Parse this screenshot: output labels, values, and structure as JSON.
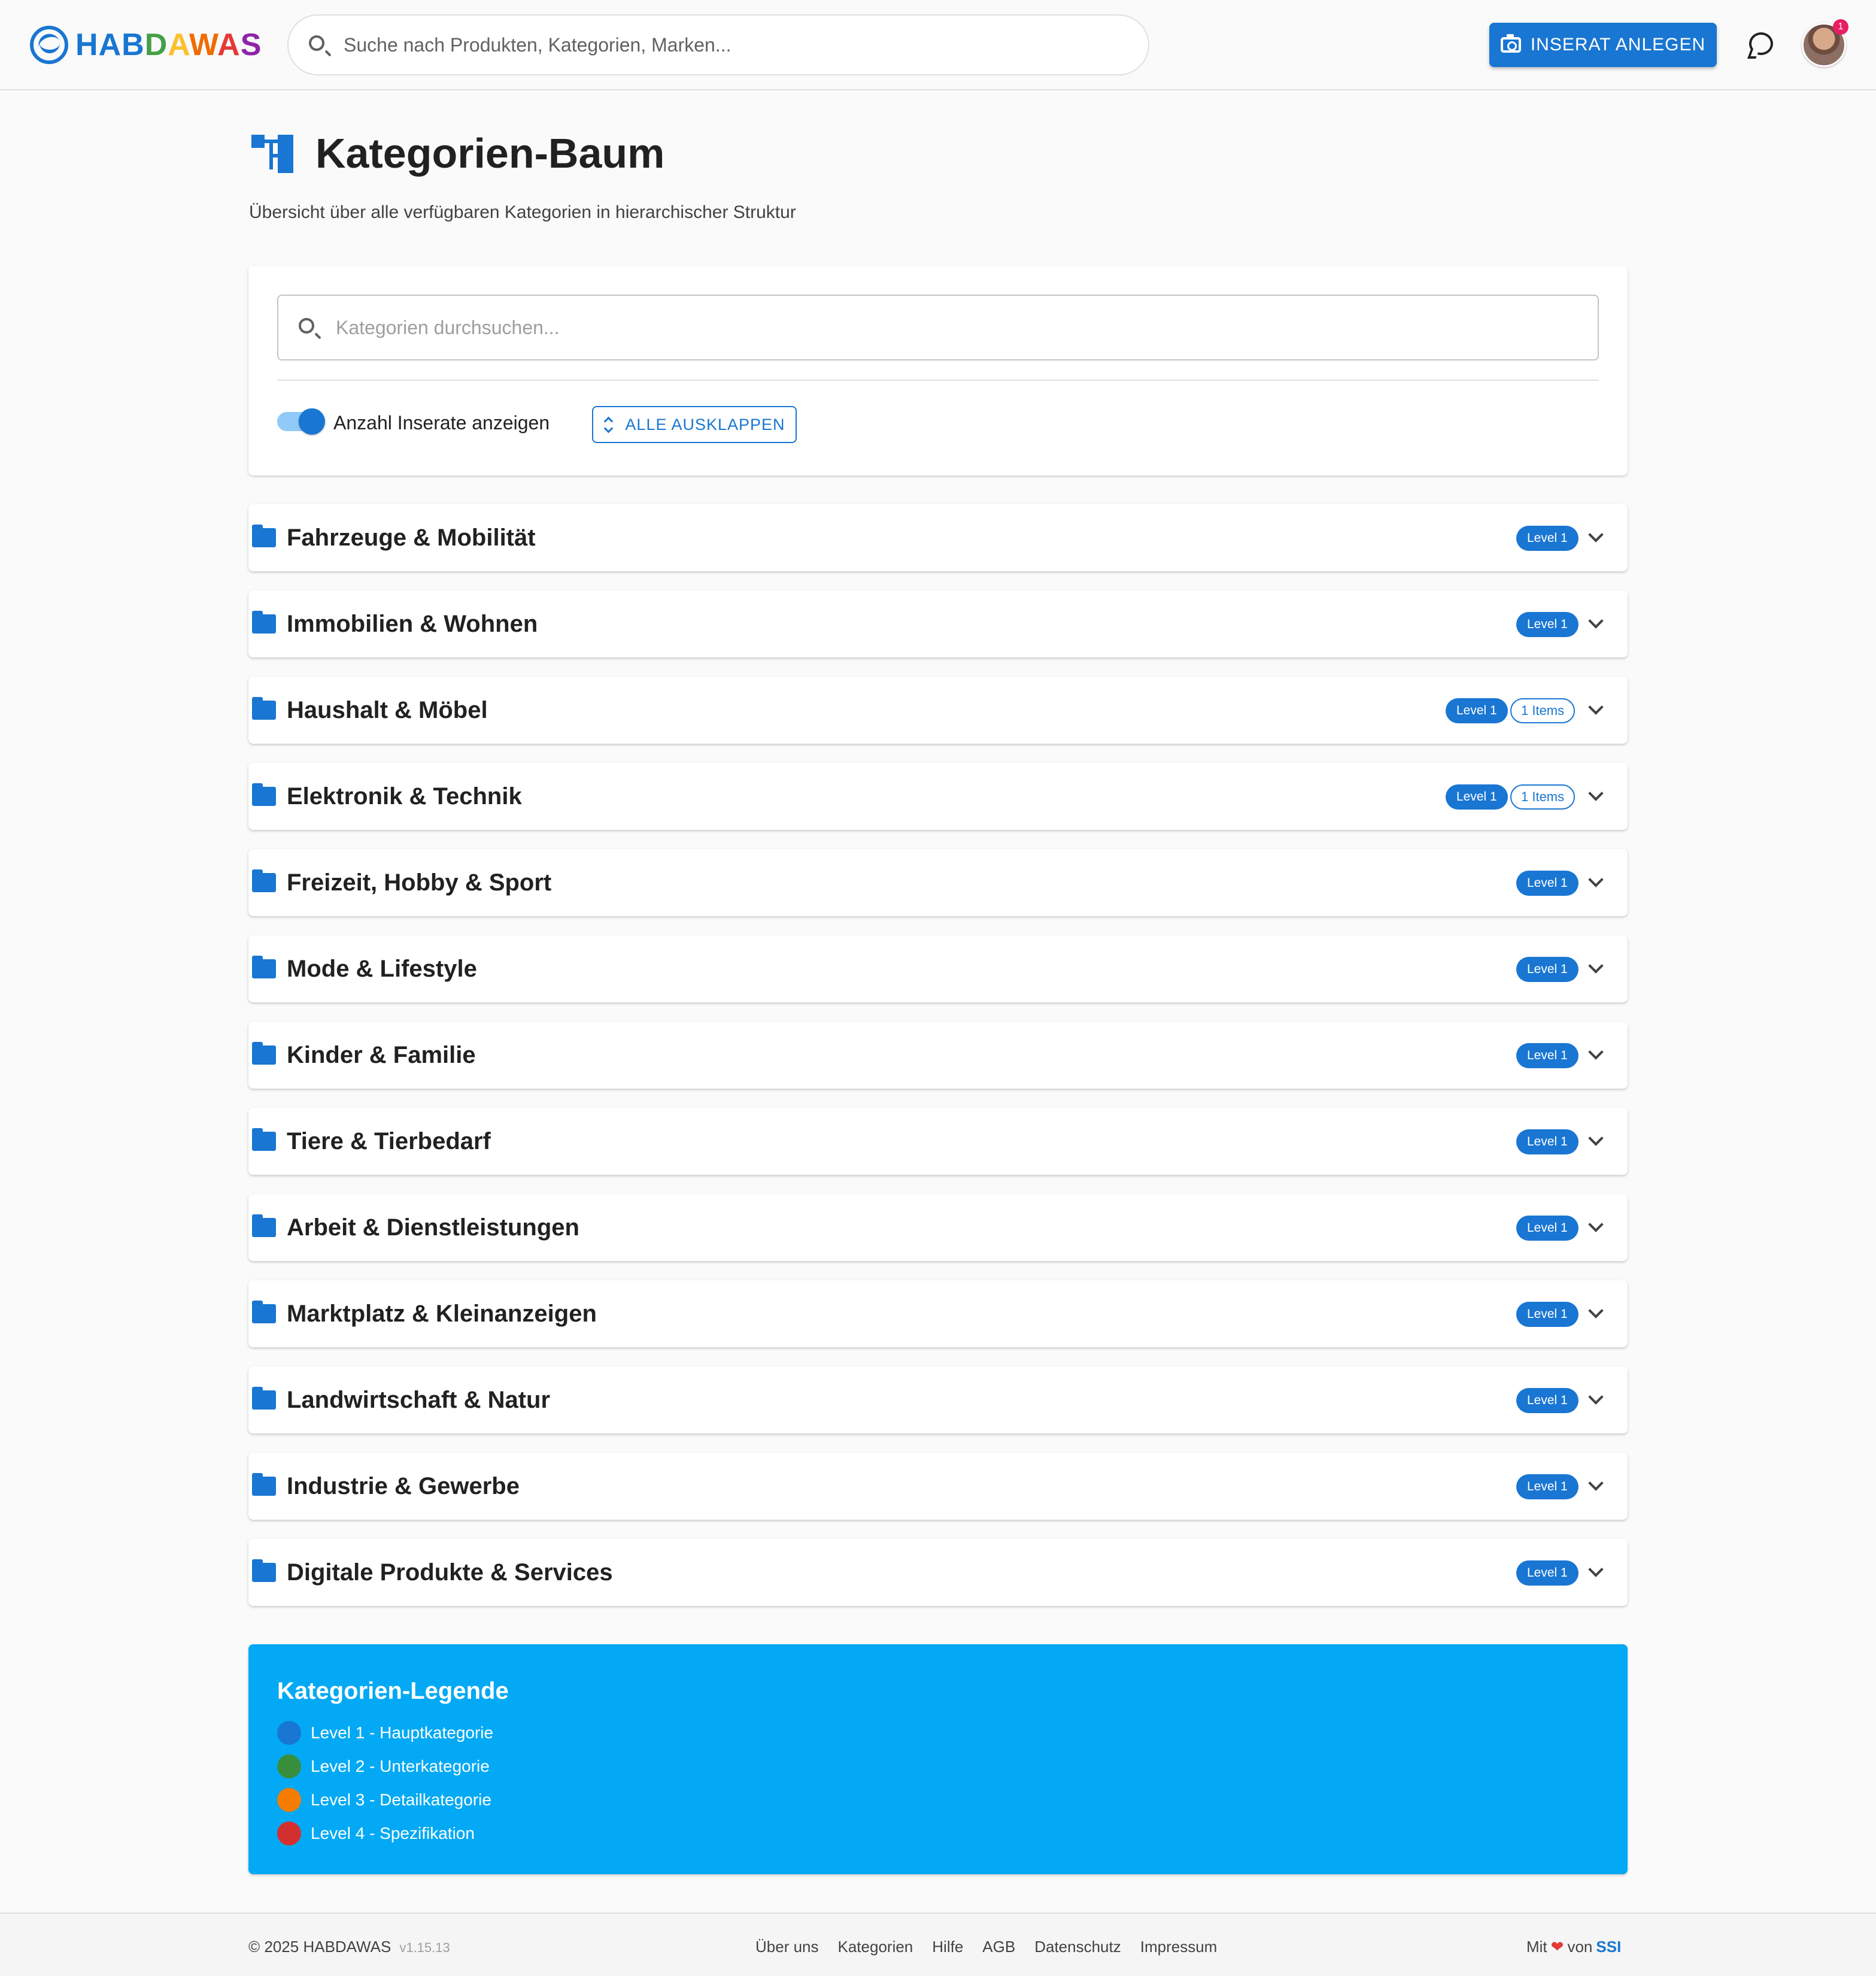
{
  "header": {
    "logo_text": "HABDAWAS",
    "search_placeholder": "Suche nach Produkten, Kategorien, Marken...",
    "create_button": "INSERAT ANLEGEN",
    "notification_count": "1",
    "icons": [
      "logo-icon",
      "search-icon",
      "camera-icon",
      "chat-icon",
      "avatar"
    ]
  },
  "page": {
    "title": "Kategorien-Baum",
    "subtitle": "Übersicht über alle verfügbaren Kategorien in hierarchischer Struktur"
  },
  "filters": {
    "search_placeholder": "Kategorien durchsuchen...",
    "toggle_label": "Anzahl Inserate anzeigen",
    "toggle_on": true,
    "expand_button": "ALLE AUSKLAPPEN"
  },
  "categories": [
    {
      "name": "Fahrzeuge & Mobilität",
      "level": "Level 1",
      "items": ""
    },
    {
      "name": "Immobilien & Wohnen",
      "level": "Level 1",
      "items": ""
    },
    {
      "name": "Haushalt & Möbel",
      "level": "Level 1",
      "items": "1 Items"
    },
    {
      "name": "Elektronik & Technik",
      "level": "Level 1",
      "items": "1 Items"
    },
    {
      "name": "Freizeit, Hobby & Sport",
      "level": "Level 1",
      "items": ""
    },
    {
      "name": "Mode & Lifestyle",
      "level": "Level 1",
      "items": ""
    },
    {
      "name": "Kinder & Familie",
      "level": "Level 1",
      "items": ""
    },
    {
      "name": "Tiere & Tierbedarf",
      "level": "Level 1",
      "items": ""
    },
    {
      "name": "Arbeit & Dienstleistungen",
      "level": "Level 1",
      "items": ""
    },
    {
      "name": "Marktplatz & Kleinanzeigen",
      "level": "Level 1",
      "items": ""
    },
    {
      "name": "Landwirtschaft & Natur",
      "level": "Level 1",
      "items": ""
    },
    {
      "name": "Industrie & Gewerbe",
      "level": "Level 1",
      "items": ""
    },
    {
      "name": "Digitale Produkte & Services",
      "level": "Level 1",
      "items": ""
    }
  ],
  "legend": {
    "title": "Kategorien-Legende",
    "items": [
      {
        "label": "Level 1 - Hauptkategorie",
        "color": "#1976d2"
      },
      {
        "label": "Level 2 - Unterkategorie",
        "color": "#388e3c"
      },
      {
        "label": "Level 3 - Detailkategorie",
        "color": "#f57c00"
      },
      {
        "label": "Level 4 - Spezifikation",
        "color": "#d32f2f"
      }
    ]
  },
  "footer": {
    "copyright": "© 2025 HABDAWAS",
    "version": "v1.15.13",
    "links": [
      "Über uns",
      "Kategorien",
      "Hilfe",
      "AGB",
      "Datenschutz",
      "Impressum"
    ],
    "made_with_prefix": "Mit",
    "made_with_middle": "von",
    "made_with_brand": "SSI"
  },
  "colors": {
    "primary": "#1976d2",
    "legend_background": "#03a9f4",
    "page_background": "#fafafa"
  }
}
